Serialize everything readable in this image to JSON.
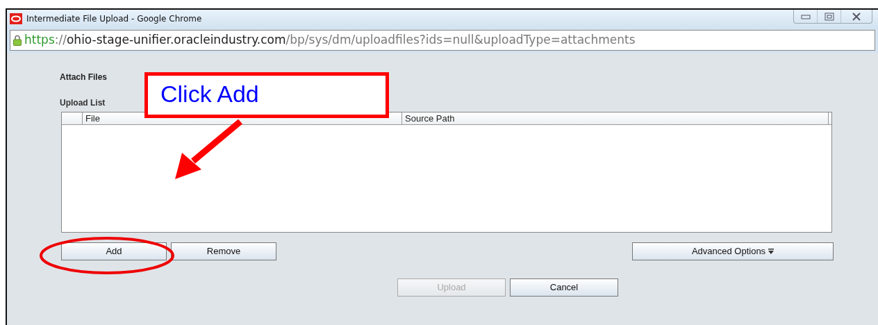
{
  "window": {
    "title": "Intermediate File Upload - Google Chrome"
  },
  "address_bar": {
    "parts": [
      {
        "text": "https",
        "kind": "scheme"
      },
      {
        "text": "://",
        "kind": "dim"
      },
      {
        "text": "ohio-stage-unifier.oracleindustry.com",
        "kind": "host"
      },
      {
        "text": "/bp/sys/dm/uploadfiles?ids=null&uploadType=attachments",
        "kind": "dim"
      }
    ]
  },
  "section_title": "Attach Files",
  "upload_list": {
    "label": "Upload List",
    "columns": [
      "File",
      "Source Path"
    ]
  },
  "list_buttons": [
    {
      "label": "Add",
      "disabled": false
    },
    {
      "label": "Remove",
      "disabled": false
    }
  ],
  "advanced_button": {
    "label": "Advanced Options"
  },
  "dialog_buttons": [
    {
      "label": "Upload",
      "disabled": true
    },
    {
      "label": "Cancel",
      "disabled": false
    }
  ],
  "annotation": {
    "callout": "Click Add"
  }
}
